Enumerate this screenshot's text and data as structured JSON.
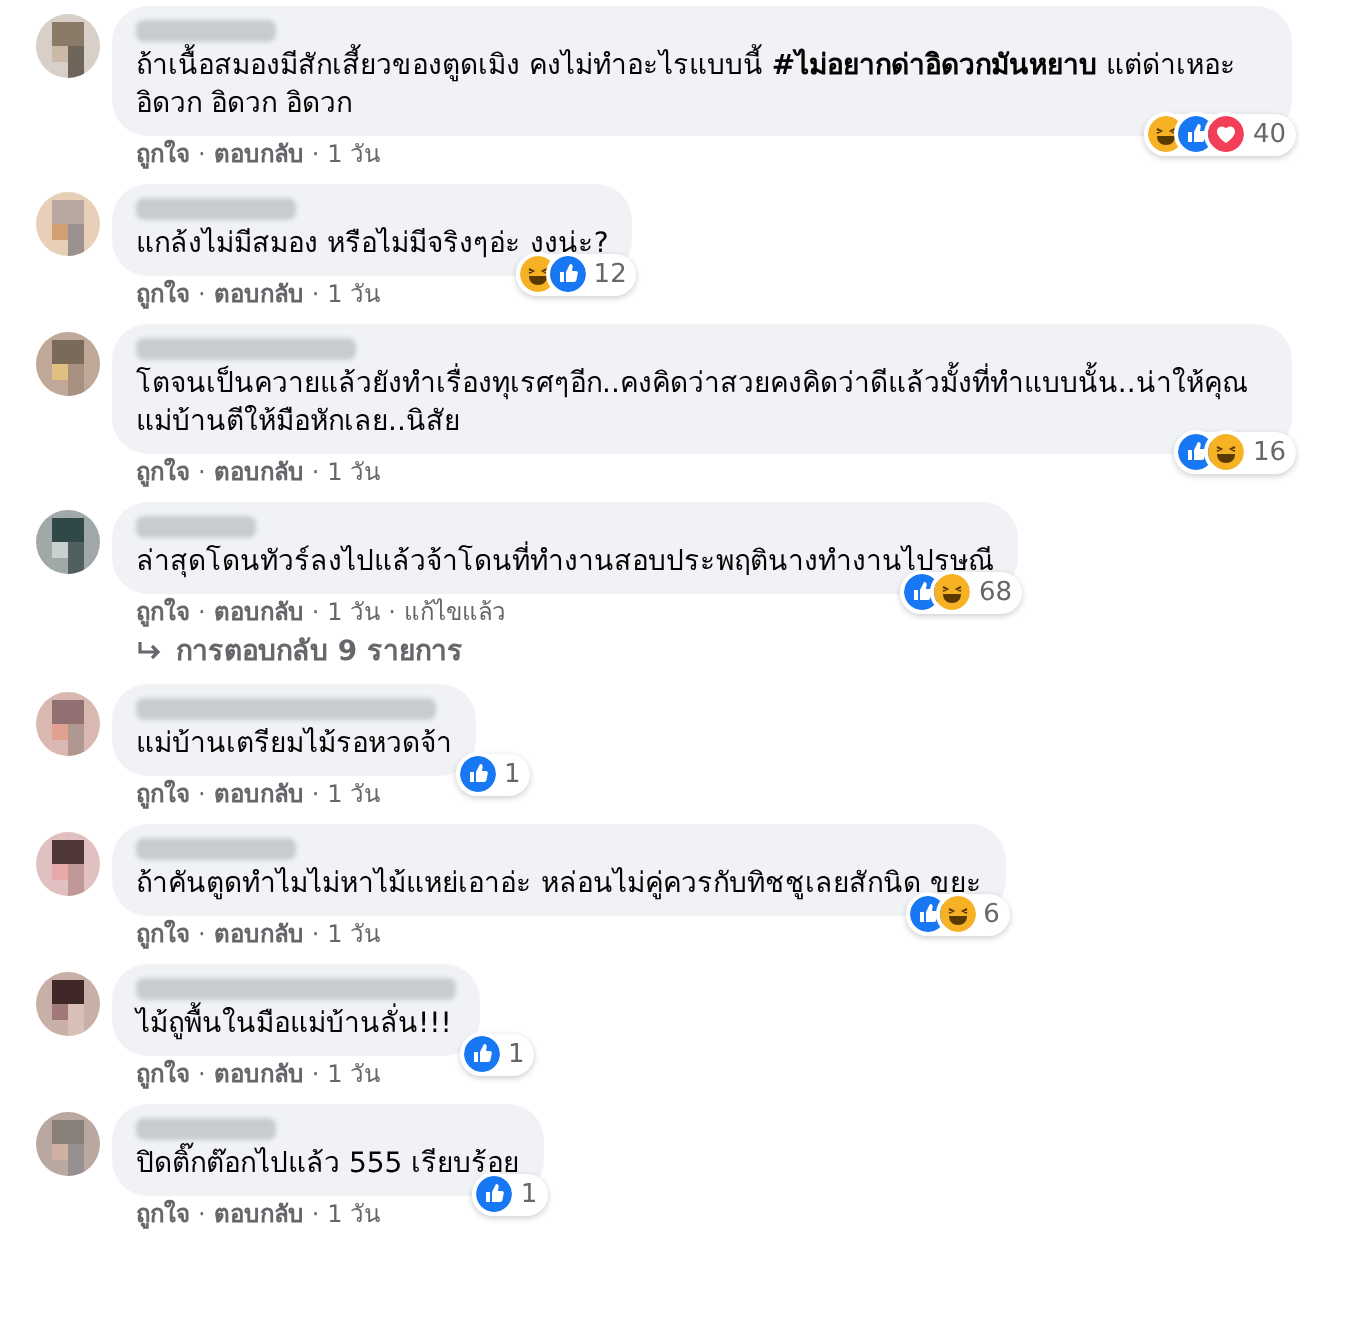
{
  "comments": [
    {
      "text": "ถ้าเนื้อสมองมีสักเสี้ยวของตูดเมิง คงไม่ทำอะไรแบบนี้ **#ไม่อยากด่าอิดวกมันหยาบ** แต่ด่าเหอะอิดวก อิดวก อิดวก",
      "reactions": [
        {
          "kind": "haha"
        },
        {
          "kind": "like"
        },
        {
          "kind": "love"
        }
      ],
      "count": "40",
      "meta": [
        {
          "kind": "link",
          "text": "ถูกใจ"
        },
        {
          "kind": "sep",
          "text": "·"
        },
        {
          "kind": "link",
          "text": "ตอบกลับ"
        },
        {
          "kind": "sep",
          "text": "·"
        },
        {
          "kind": "time",
          "text": "1 วัน"
        }
      ]
    },
    {
      "text": "แกล้งไม่มีสมอง หรือไม่มีจริงๆอ่ะ งงน่ะ?",
      "reactions": [
        {
          "kind": "haha"
        },
        {
          "kind": "like"
        }
      ],
      "count": "12",
      "meta": [
        {
          "kind": "link",
          "text": "ถูกใจ"
        },
        {
          "kind": "sep",
          "text": "·"
        },
        {
          "kind": "link",
          "text": "ตอบกลับ"
        },
        {
          "kind": "sep",
          "text": "·"
        },
        {
          "kind": "time",
          "text": "1 วัน"
        }
      ]
    },
    {
      "text": "โตจนเป็นควายแล้วยังทำเรื่องทุเรศๆอีก..คงคิดว่าสวยคงคิดว่าดีแล้วมั้งที่ทำแบบนั้น..น่าให้คุณแม่บ้านตีให้มือหักเลย..นิสัย",
      "reactions": [
        {
          "kind": "like"
        },
        {
          "kind": "haha"
        }
      ],
      "count": "16",
      "meta": [
        {
          "kind": "link",
          "text": "ถูกใจ"
        },
        {
          "kind": "sep",
          "text": "·"
        },
        {
          "kind": "link",
          "text": "ตอบกลับ"
        },
        {
          "kind": "sep",
          "text": "·"
        },
        {
          "kind": "time",
          "text": "1 วัน"
        }
      ]
    },
    {
      "text": "ล่าสุดโดนทัวร์ลงไปแล้วจ้าโดนที่ทำงานสอบประพฤตินางทำงานไปรษณี",
      "reactions": [
        {
          "kind": "like"
        },
        {
          "kind": "haha"
        }
      ],
      "count": "68",
      "meta": [
        {
          "kind": "link",
          "text": "ถูกใจ"
        },
        {
          "kind": "sep",
          "text": "·"
        },
        {
          "kind": "link",
          "text": "ตอบกลับ"
        },
        {
          "kind": "sep",
          "text": "·"
        },
        {
          "kind": "time",
          "text": "1 วัน"
        },
        {
          "kind": "sep",
          "text": "·"
        },
        {
          "kind": "time",
          "text": "แก้ไขแล้ว"
        }
      ],
      "replies": "การตอบกลับ 9 รายการ"
    },
    {
      "text": "แม่บ้านเตรียมไม้รอหวดจ้า",
      "reactions": [
        {
          "kind": "like"
        }
      ],
      "count": "1",
      "meta": [
        {
          "kind": "link",
          "text": "ถูกใจ"
        },
        {
          "kind": "sep",
          "text": "·"
        },
        {
          "kind": "link",
          "text": "ตอบกลับ"
        },
        {
          "kind": "sep",
          "text": "·"
        },
        {
          "kind": "time",
          "text": "1 วัน"
        }
      ]
    },
    {
      "text": "ถ้าคันตูดทำไมไม่หาไม้แหย่เอาอ่ะ หล่อนไม่คู่ควรกับทิชชูเลยสักนิด ขยะ",
      "reactions": [
        {
          "kind": "like"
        },
        {
          "kind": "haha"
        }
      ],
      "count": "6",
      "meta": [
        {
          "kind": "link",
          "text": "ถูกใจ"
        },
        {
          "kind": "sep",
          "text": "·"
        },
        {
          "kind": "link",
          "text": "ตอบกลับ"
        },
        {
          "kind": "sep",
          "text": "·"
        },
        {
          "kind": "time",
          "text": "1 วัน"
        }
      ]
    },
    {
      "text": "ไม้ถูพื้นในมือแม่บ้านลั่น!!!",
      "reactions": [
        {
          "kind": "like"
        }
      ],
      "count": "1",
      "meta": [
        {
          "kind": "link",
          "text": "ถูกใจ"
        },
        {
          "kind": "sep",
          "text": "·"
        },
        {
          "kind": "link",
          "text": "ตอบกลับ"
        },
        {
          "kind": "sep",
          "text": "·"
        },
        {
          "kind": "time",
          "text": "1 วัน"
        }
      ]
    },
    {
      "text": "ปิดติ๊กต๊อกไปแล้ว 555 เรียบร้อย",
      "reactions": [
        {
          "kind": "like"
        }
      ],
      "count": "1",
      "meta": [
        {
          "kind": "link",
          "text": "ถูกใจ"
        },
        {
          "kind": "sep",
          "text": "·"
        },
        {
          "kind": "link",
          "text": "ตอบกลับ"
        },
        {
          "kind": "sep",
          "text": "·"
        },
        {
          "kind": "time",
          "text": "1 วัน"
        }
      ]
    }
  ]
}
